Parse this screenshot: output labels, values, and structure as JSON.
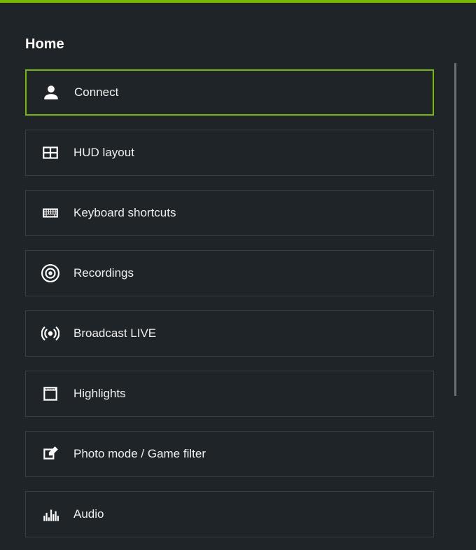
{
  "header": {
    "title": "Home"
  },
  "menu": {
    "items": [
      {
        "label": "Connect",
        "icon": "user-icon",
        "selected": true
      },
      {
        "label": "HUD layout",
        "icon": "hud-layout-icon",
        "selected": false
      },
      {
        "label": "Keyboard shortcuts",
        "icon": "keyboard-icon",
        "selected": false
      },
      {
        "label": "Recordings",
        "icon": "recordings-icon",
        "selected": false
      },
      {
        "label": "Broadcast LIVE",
        "icon": "broadcast-icon",
        "selected": false
      },
      {
        "label": "Highlights",
        "icon": "highlights-icon",
        "selected": false
      },
      {
        "label": "Photo mode / Game filter",
        "icon": "photo-mode-icon",
        "selected": false
      },
      {
        "label": "Audio",
        "icon": "audio-icon",
        "selected": false
      }
    ]
  },
  "colors": {
    "accent": "#76b900",
    "background": "#1f2428",
    "border": "#3a3f44"
  }
}
